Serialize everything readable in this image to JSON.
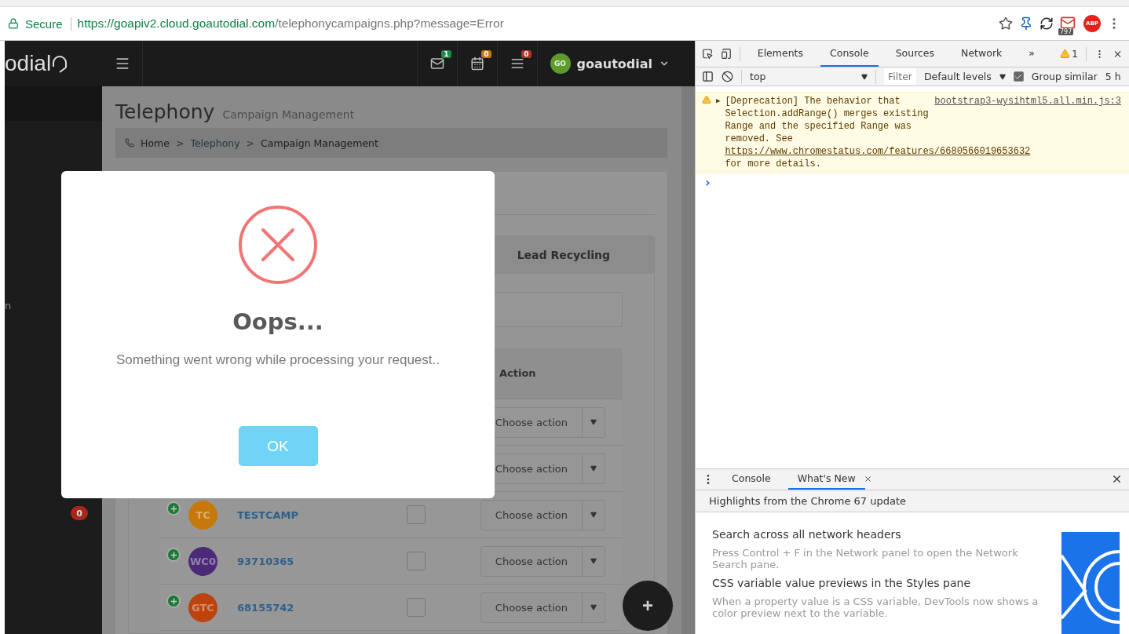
{
  "browser": {
    "secure": "Secure",
    "url_host": "https://goapiv2.cloud.goautodial.com",
    "url_path": "/telephonycampaigns.php?message=Error",
    "mail_count": "797",
    "adblock": "ABP"
  },
  "app": {
    "logo": "odial",
    "notifications": [
      {
        "kind": "mail",
        "count": "1",
        "color": "#1e8a4c"
      },
      {
        "kind": "calendar",
        "count": "0",
        "color": "#c27a10"
      },
      {
        "kind": "tasks",
        "count": "0",
        "color": "#b03328"
      }
    ],
    "user": {
      "initials": "GO",
      "name": "goautodial"
    },
    "sidebar": {
      "fragment": "n",
      "badge": "0"
    },
    "page": {
      "title": "Telephony",
      "subtitle": "Campaign Management",
      "separator": ">",
      "breadcrumb": [
        {
          "label": "Home",
          "kind": "link"
        },
        {
          "label": "Telephony",
          "kind": "link"
        },
        {
          "label": "Campaign Management",
          "kind": "current"
        }
      ]
    },
    "tab": "Lead Recycling",
    "table": {
      "column": "Action",
      "rows": [
        {
          "action": "Choose action"
        },
        {
          "action": "Choose action"
        },
        {
          "initials": "TC",
          "color": "#c6780c",
          "name": "TESTCAMP",
          "checked": false,
          "action": "Choose action"
        },
        {
          "initials": "WC0",
          "color": "#4c2a78",
          "name": "93710365",
          "checked": false,
          "action": "Choose action"
        },
        {
          "initials": "GTC",
          "color": "#bc420e",
          "name": "68155742",
          "checked": false,
          "action": "Choose action"
        }
      ]
    },
    "fab": "+"
  },
  "modal": {
    "title": "Oops...",
    "message": "Something went wrong while processing your request..",
    "button": "OK"
  },
  "devtools": {
    "tabs": [
      {
        "label": "Elements",
        "selected": false
      },
      {
        "label": "Console",
        "selected": true
      },
      {
        "label": "Sources",
        "selected": false
      },
      {
        "label": "Network",
        "selected": false
      }
    ],
    "more": "»",
    "warnings": "1",
    "context": "top",
    "filter": "Filter",
    "levels": "Default levels",
    "group_similar": {
      "label": "Group similar",
      "checked": true
    },
    "cut_label": "5 h",
    "messages": [
      {
        "kind": "warning",
        "expand": "▶",
        "text": "[Deprecation] The behavior that Selection.addRange() merges existing Range and the specified Range was removed. See",
        "link": "https://www.chromestatus.com/features/6680566019653632",
        "tail": "for more details.",
        "source": "bootstrap3-wysihtml5.all.min.js:3"
      }
    ],
    "prompt": "›",
    "drawer": {
      "tabs": [
        {
          "label": "Console",
          "selected": false,
          "closable": false
        },
        {
          "label": "What's New",
          "selected": true,
          "closable": true
        }
      ],
      "banner": "Highlights from the Chrome 67 update",
      "items": [
        {
          "title": "Search across all network headers",
          "body": "Press Control + F in the Network panel to open the Network Search pane."
        },
        {
          "title": "CSS variable value previews in the Styles pane",
          "body": "When a property value is a CSS variable, DevTools now shows a color preview next to the variable."
        }
      ]
    }
  }
}
